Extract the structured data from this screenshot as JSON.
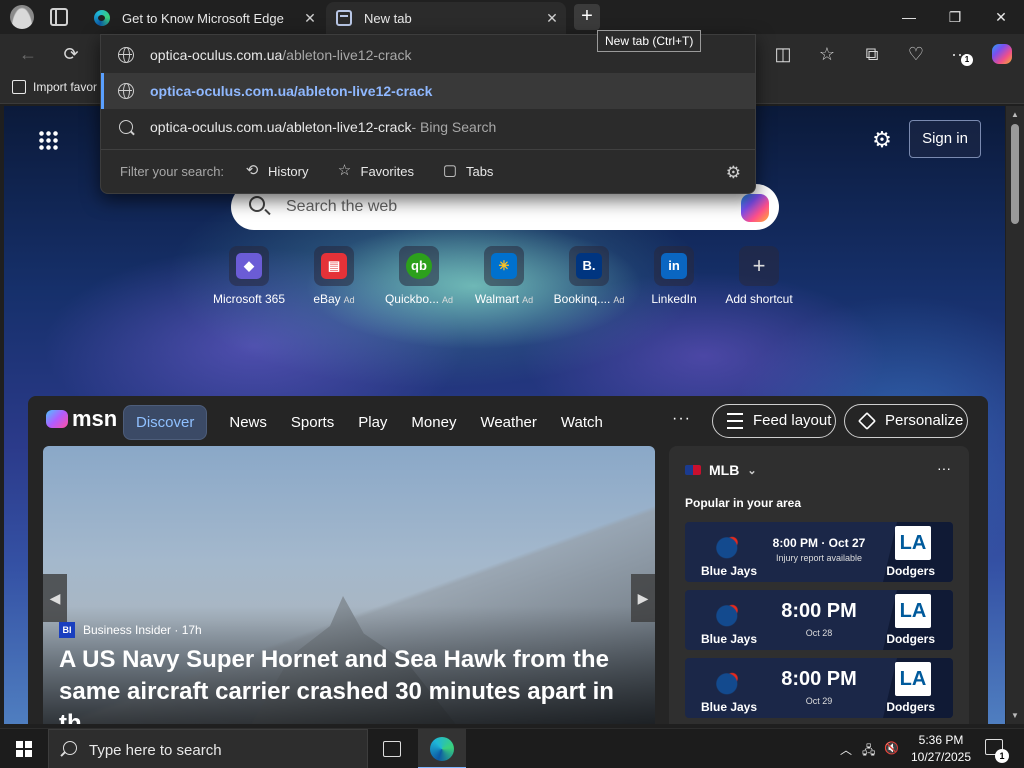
{
  "window": {
    "tabs": [
      {
        "label": "Get to Know Microsoft Edge",
        "icon": "edge-icon",
        "close": "✕"
      },
      {
        "label": "New tab",
        "icon": "newtab-icon",
        "close": "✕"
      }
    ],
    "new_tab_button": "+",
    "new_tab_tooltip": "New tab (Ctrl+T)",
    "controls": {
      "minimize": "—",
      "maximize": "❐",
      "close": "✕"
    }
  },
  "toolbar": {
    "back": "←",
    "refresh": "⟳",
    "split_screen": "◫",
    "favorites": "☆",
    "collections": "⧉",
    "health": "♡",
    "more": "···",
    "more_badge": "1"
  },
  "favorites_bar": {
    "import_label": "Import favor"
  },
  "address_dropdown": {
    "suggestions": [
      {
        "bold": "optica-oculus.com.ua",
        "rest": "/ableton-live12-crack",
        "icon": "globe-icon"
      },
      {
        "bold": "optica-oculus.com.ua/ableton-live12-crack",
        "rest": "",
        "icon": "globe-icon"
      },
      {
        "bold": "optica-oculus.com.ua/ableton-live12-crack",
        "rest": " - Bing Search",
        "icon": "search-icon"
      }
    ],
    "filter_label": "Filter your search:",
    "filters": [
      {
        "label": "History",
        "icon": "⟲"
      },
      {
        "label": "Favorites",
        "icon": "☆"
      },
      {
        "label": "Tabs",
        "icon": "▢"
      }
    ],
    "settings_icon": "⚙"
  },
  "newtab": {
    "signin": "Sign in",
    "settings_icon": "⚙",
    "search_placeholder": "Search the web",
    "shortcuts": [
      {
        "label": "Microsoft 365",
        "ad": "",
        "glyph": "◆",
        "color": "#6b5cd6"
      },
      {
        "label": "eBay",
        "ad": "Ad",
        "glyph": "▤",
        "color": "#e53238"
      },
      {
        "label": "Quickbo...",
        "ad": "Ad",
        "glyph": "qb",
        "color": "#2ca01c"
      },
      {
        "label": "Walmart",
        "ad": "Ad",
        "glyph": "✳",
        "color": "#0071ce"
      },
      {
        "label": "Bookinq....",
        "ad": "Ad",
        "glyph": "B.",
        "color": "#003580"
      },
      {
        "label": "LinkedIn",
        "ad": "",
        "glyph": "in",
        "color": "#0a66c2"
      },
      {
        "label": "Add shortcut",
        "ad": "",
        "glyph": "+",
        "color": "transparent"
      }
    ]
  },
  "msn": {
    "logo_text": "msn",
    "nav": [
      "Discover",
      "News",
      "Sports",
      "Play",
      "Money",
      "Weather",
      "Watch"
    ],
    "more": "···",
    "feed_layout": "Feed layout",
    "personalize": "Personalize",
    "hero": {
      "source_logo": "BI",
      "source": "Business Insider · 17h",
      "title": "A US Navy Super Hornet and Sea Hawk from the same aircraft carrier crashed 30 minutes apart in th...",
      "prev": "◀",
      "next": "▶"
    },
    "mlb": {
      "title": "MLB",
      "chevron": "⌄",
      "more": "···",
      "subtitle": "Popular in your area",
      "games": [
        {
          "home": "Blue Jays",
          "away": "Dodgers",
          "time": "8:00 PM · Oct 27",
          "sub": "Injury report available",
          "style": "small"
        },
        {
          "home": "Blue Jays",
          "away": "Dodgers",
          "time": "8:00 PM",
          "sub": "Oct 28",
          "style": "big"
        },
        {
          "home": "Blue Jays",
          "away": "Dodgers",
          "time": "8:00 PM",
          "sub": "Oct 29",
          "style": "big"
        }
      ],
      "dodgers_mark": "LA"
    }
  },
  "taskbar": {
    "search_placeholder": "Type here to search",
    "tray_chevron": "︿",
    "network": "🖧",
    "volume": "🔇",
    "time": "5:36 PM",
    "date": "10/27/2025",
    "notif_badge": "1"
  },
  "colors": {
    "accent": "#5aa0ff",
    "discover_active": "#8fc0ff",
    "edge_blue": "#0c59a4"
  }
}
